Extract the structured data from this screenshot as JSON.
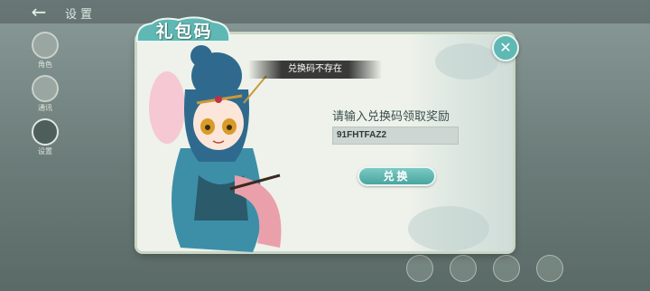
{
  "header": {
    "title": "设置"
  },
  "sidebar": {
    "items": [
      {
        "label": "角色",
        "active": false
      },
      {
        "label": "通讯",
        "active": false
      },
      {
        "label": "设置",
        "active": true
      }
    ]
  },
  "modal": {
    "title": "礼包码",
    "toast": "兑换码不存在",
    "prompt": "请输入兑换码领取奖励",
    "code_value": "91FHTFAZ2",
    "redeem_label": "兑换"
  },
  "colors": {
    "accent": "#5fb8b3",
    "panel": "#eef2ea",
    "text": "#3a4f4d"
  }
}
